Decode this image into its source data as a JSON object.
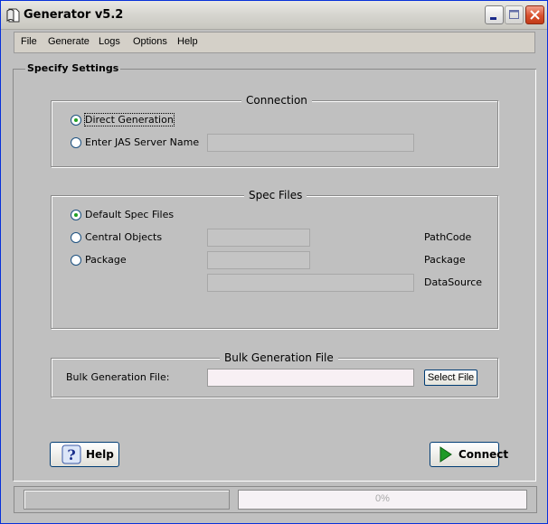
{
  "window": {
    "title": "Generator v5.2"
  },
  "menu": {
    "items": [
      {
        "label": "File"
      },
      {
        "label": "Generate"
      },
      {
        "label": "Logs"
      },
      {
        "label": "Options"
      },
      {
        "label": "Help"
      }
    ]
  },
  "panel": {
    "title": "Specify Settings"
  },
  "connection": {
    "title": "Connection",
    "direct_label": "Direct Generation",
    "direct_checked": true,
    "jas_label": "Enter JAS Server Name",
    "jas_value": ""
  },
  "spec_files": {
    "title": "Spec Files",
    "default_label": "Default Spec Files",
    "default_checked": true,
    "central_label": "Central Objects",
    "package_label": "Package",
    "pathcode_label": "PathCode",
    "package_field_label": "Package",
    "datasource_label": "DataSource",
    "pathcode_value": "",
    "package_value": "",
    "datasource_value": ""
  },
  "bulk": {
    "title": "Bulk Generation File",
    "field_label": "Bulk Generation File:",
    "field_value": "",
    "select_button": "Select File"
  },
  "buttons": {
    "help": "Help",
    "connect": "Connect",
    "help_icon": "question-icon",
    "connect_icon": "play-arrow-icon"
  },
  "status": {
    "message": "",
    "progress": 0,
    "progress_text": "0%"
  },
  "colors": {
    "background": "#C0C0C0",
    "radio_dot": "#21A121",
    "button_border": "#003C74",
    "close_button": "#D8502D"
  }
}
